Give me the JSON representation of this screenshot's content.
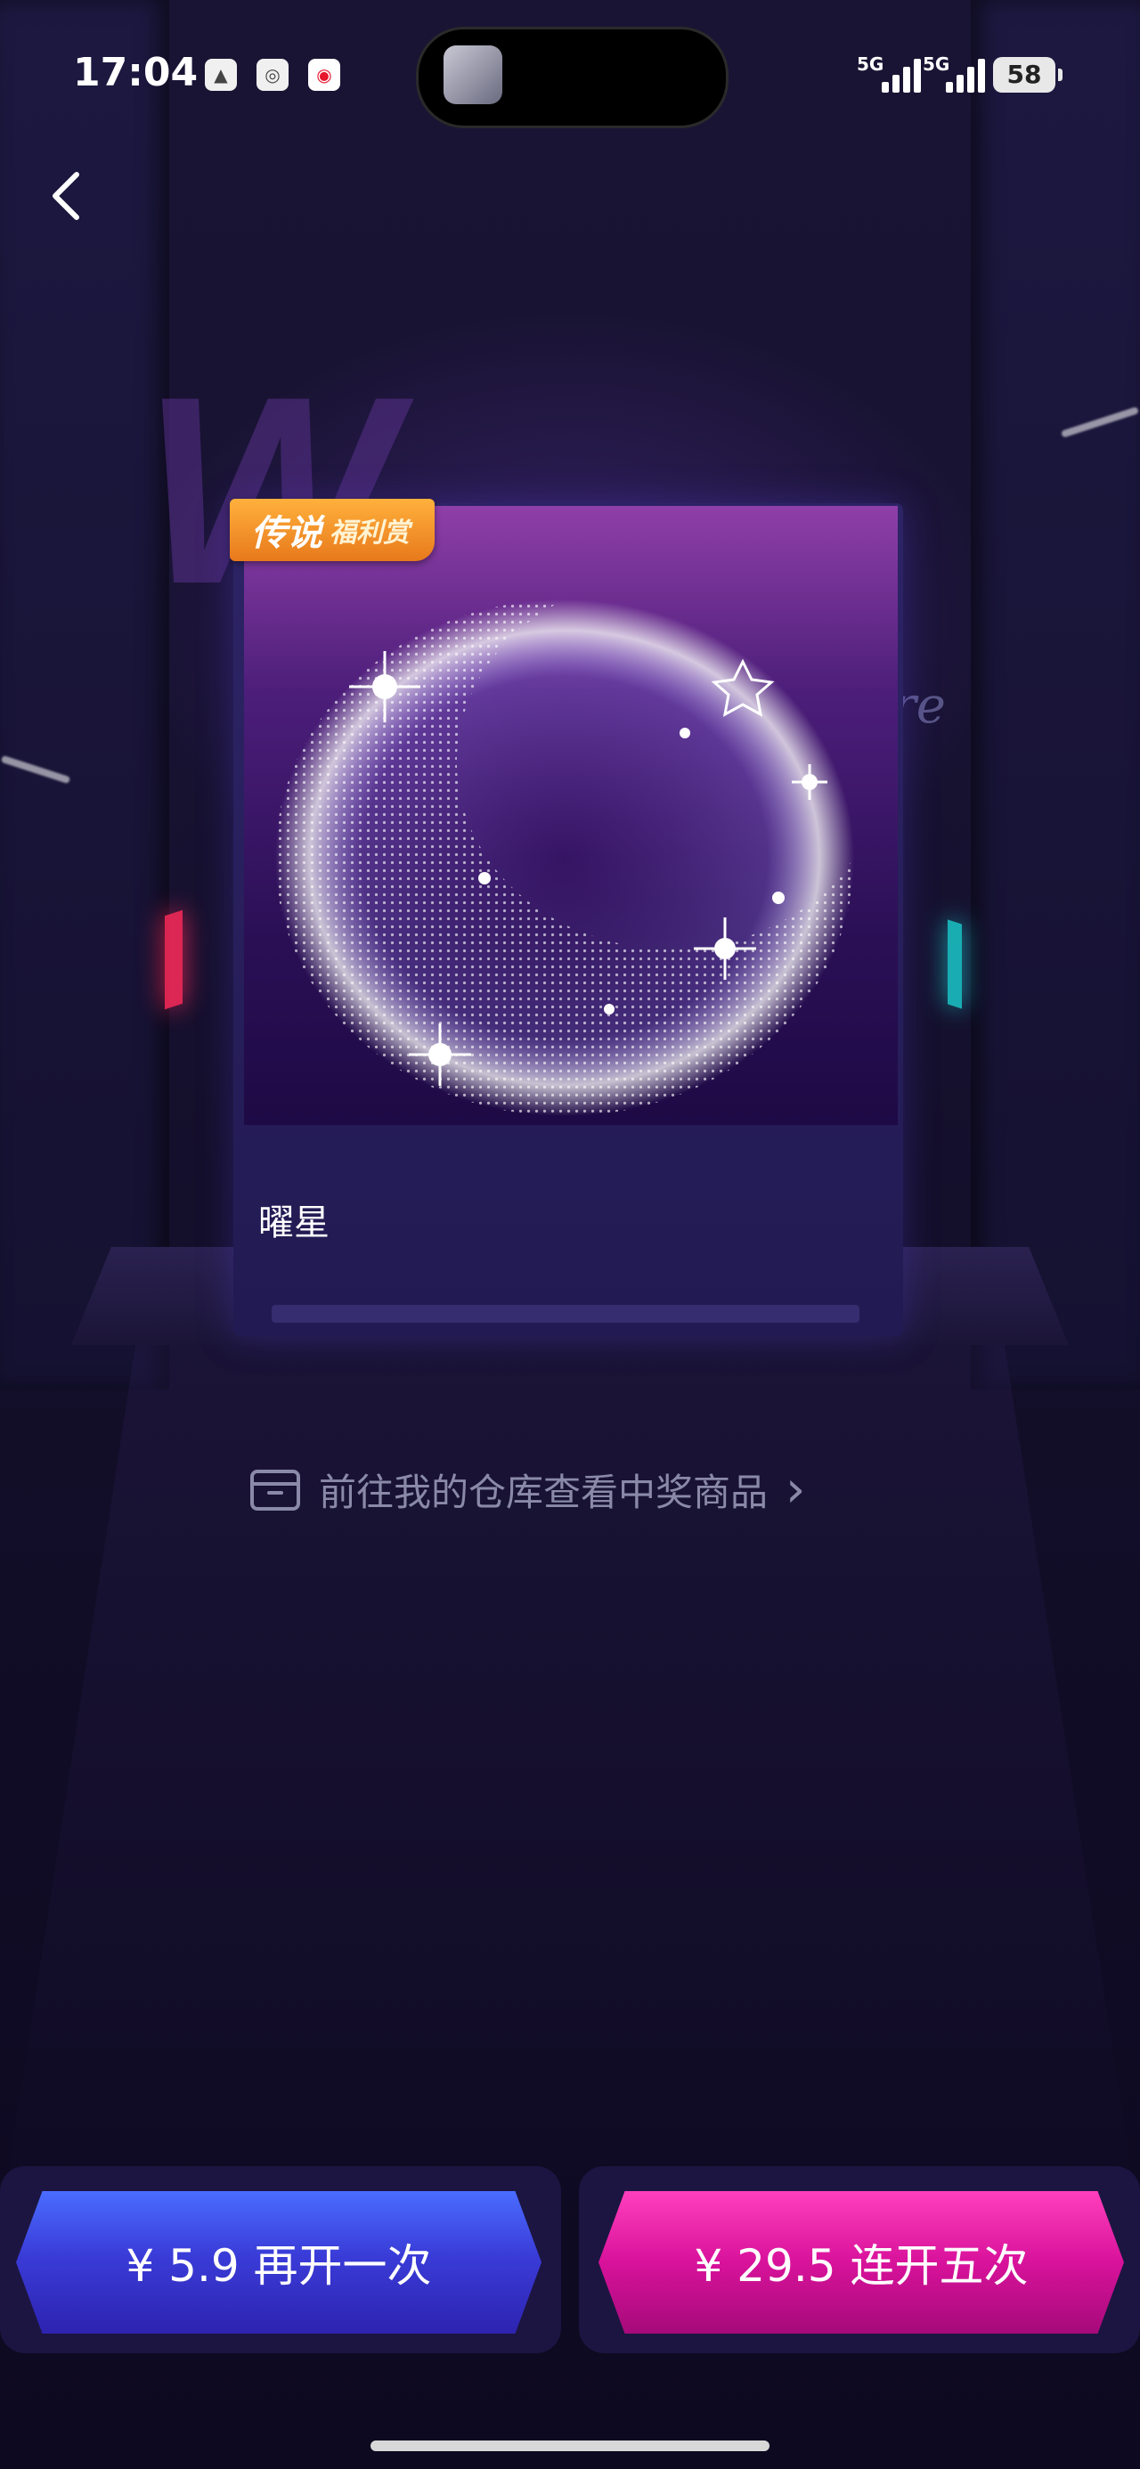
{
  "status_bar": {
    "time": "17:04",
    "network_1": "5G",
    "network_2": "5G",
    "battery": "58"
  },
  "nav": {
    "back_icon": "chevron-left-icon"
  },
  "background": {
    "script_text": "lfare"
  },
  "prize_card": {
    "badge_main": "传说",
    "badge_sub": "福利赏",
    "name": "曜星"
  },
  "warehouse_link": {
    "icon": "box-icon",
    "text": "前往我的仓库查看中奖商品",
    "chevron": "›"
  },
  "actions": {
    "again_label": "¥ 5.9 再开一次",
    "five_label": "¥ 29.5 连开五次"
  },
  "colors": {
    "background": "#130e29",
    "badge": "#f19a2a",
    "blue_button": "#3a3cd8",
    "pink_button": "#d8129b"
  }
}
